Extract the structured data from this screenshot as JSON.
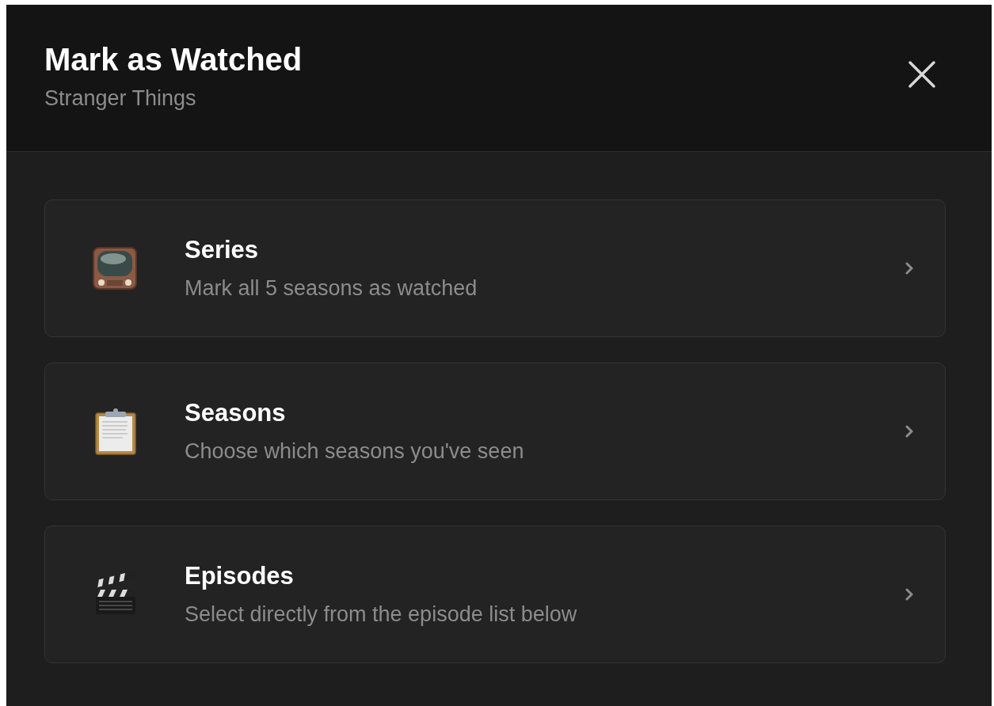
{
  "dialog": {
    "title": "Mark as Watched",
    "subtitle": "Stranger Things"
  },
  "options": [
    {
      "kind": "tv",
      "title": "Series",
      "description": "Mark all 5 seasons as watched"
    },
    {
      "kind": "clipboard",
      "title": "Seasons",
      "description": "Choose which seasons you've seen"
    },
    {
      "kind": "clapper",
      "title": "Episodes",
      "description": "Select directly from the episode list below"
    }
  ]
}
